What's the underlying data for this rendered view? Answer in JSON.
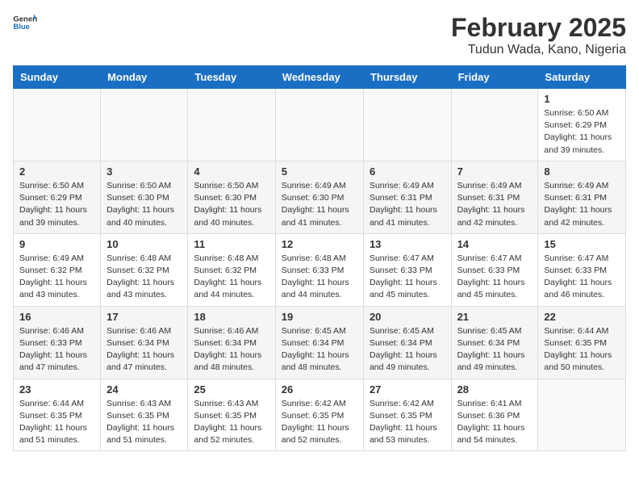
{
  "header": {
    "logo_general": "General",
    "logo_blue": "Blue",
    "month_title": "February 2025",
    "location": "Tudun Wada, Kano, Nigeria"
  },
  "weekdays": [
    "Sunday",
    "Monday",
    "Tuesday",
    "Wednesday",
    "Thursday",
    "Friday",
    "Saturday"
  ],
  "weeks": [
    [
      {
        "day": "",
        "info": ""
      },
      {
        "day": "",
        "info": ""
      },
      {
        "day": "",
        "info": ""
      },
      {
        "day": "",
        "info": ""
      },
      {
        "day": "",
        "info": ""
      },
      {
        "day": "",
        "info": ""
      },
      {
        "day": "1",
        "info": "Sunrise: 6:50 AM\nSunset: 6:29 PM\nDaylight: 11 hours and 39 minutes."
      }
    ],
    [
      {
        "day": "2",
        "info": "Sunrise: 6:50 AM\nSunset: 6:29 PM\nDaylight: 11 hours and 39 minutes."
      },
      {
        "day": "3",
        "info": "Sunrise: 6:50 AM\nSunset: 6:30 PM\nDaylight: 11 hours and 40 minutes."
      },
      {
        "day": "4",
        "info": "Sunrise: 6:50 AM\nSunset: 6:30 PM\nDaylight: 11 hours and 40 minutes."
      },
      {
        "day": "5",
        "info": "Sunrise: 6:49 AM\nSunset: 6:30 PM\nDaylight: 11 hours and 41 minutes."
      },
      {
        "day": "6",
        "info": "Sunrise: 6:49 AM\nSunset: 6:31 PM\nDaylight: 11 hours and 41 minutes."
      },
      {
        "day": "7",
        "info": "Sunrise: 6:49 AM\nSunset: 6:31 PM\nDaylight: 11 hours and 42 minutes."
      },
      {
        "day": "8",
        "info": "Sunrise: 6:49 AM\nSunset: 6:31 PM\nDaylight: 11 hours and 42 minutes."
      }
    ],
    [
      {
        "day": "9",
        "info": "Sunrise: 6:49 AM\nSunset: 6:32 PM\nDaylight: 11 hours and 43 minutes."
      },
      {
        "day": "10",
        "info": "Sunrise: 6:48 AM\nSunset: 6:32 PM\nDaylight: 11 hours and 43 minutes."
      },
      {
        "day": "11",
        "info": "Sunrise: 6:48 AM\nSunset: 6:32 PM\nDaylight: 11 hours and 44 minutes."
      },
      {
        "day": "12",
        "info": "Sunrise: 6:48 AM\nSunset: 6:33 PM\nDaylight: 11 hours and 44 minutes."
      },
      {
        "day": "13",
        "info": "Sunrise: 6:47 AM\nSunset: 6:33 PM\nDaylight: 11 hours and 45 minutes."
      },
      {
        "day": "14",
        "info": "Sunrise: 6:47 AM\nSunset: 6:33 PM\nDaylight: 11 hours and 45 minutes."
      },
      {
        "day": "15",
        "info": "Sunrise: 6:47 AM\nSunset: 6:33 PM\nDaylight: 11 hours and 46 minutes."
      }
    ],
    [
      {
        "day": "16",
        "info": "Sunrise: 6:46 AM\nSunset: 6:33 PM\nDaylight: 11 hours and 47 minutes."
      },
      {
        "day": "17",
        "info": "Sunrise: 6:46 AM\nSunset: 6:34 PM\nDaylight: 11 hours and 47 minutes."
      },
      {
        "day": "18",
        "info": "Sunrise: 6:46 AM\nSunset: 6:34 PM\nDaylight: 11 hours and 48 minutes."
      },
      {
        "day": "19",
        "info": "Sunrise: 6:45 AM\nSunset: 6:34 PM\nDaylight: 11 hours and 48 minutes."
      },
      {
        "day": "20",
        "info": "Sunrise: 6:45 AM\nSunset: 6:34 PM\nDaylight: 11 hours and 49 minutes."
      },
      {
        "day": "21",
        "info": "Sunrise: 6:45 AM\nSunset: 6:34 PM\nDaylight: 11 hours and 49 minutes."
      },
      {
        "day": "22",
        "info": "Sunrise: 6:44 AM\nSunset: 6:35 PM\nDaylight: 11 hours and 50 minutes."
      }
    ],
    [
      {
        "day": "23",
        "info": "Sunrise: 6:44 AM\nSunset: 6:35 PM\nDaylight: 11 hours and 51 minutes."
      },
      {
        "day": "24",
        "info": "Sunrise: 6:43 AM\nSunset: 6:35 PM\nDaylight: 11 hours and 51 minutes."
      },
      {
        "day": "25",
        "info": "Sunrise: 6:43 AM\nSunset: 6:35 PM\nDaylight: 11 hours and 52 minutes."
      },
      {
        "day": "26",
        "info": "Sunrise: 6:42 AM\nSunset: 6:35 PM\nDaylight: 11 hours and 52 minutes."
      },
      {
        "day": "27",
        "info": "Sunrise: 6:42 AM\nSunset: 6:35 PM\nDaylight: 11 hours and 53 minutes."
      },
      {
        "day": "28",
        "info": "Sunrise: 6:41 AM\nSunset: 6:36 PM\nDaylight: 11 hours and 54 minutes."
      },
      {
        "day": "",
        "info": ""
      }
    ]
  ]
}
